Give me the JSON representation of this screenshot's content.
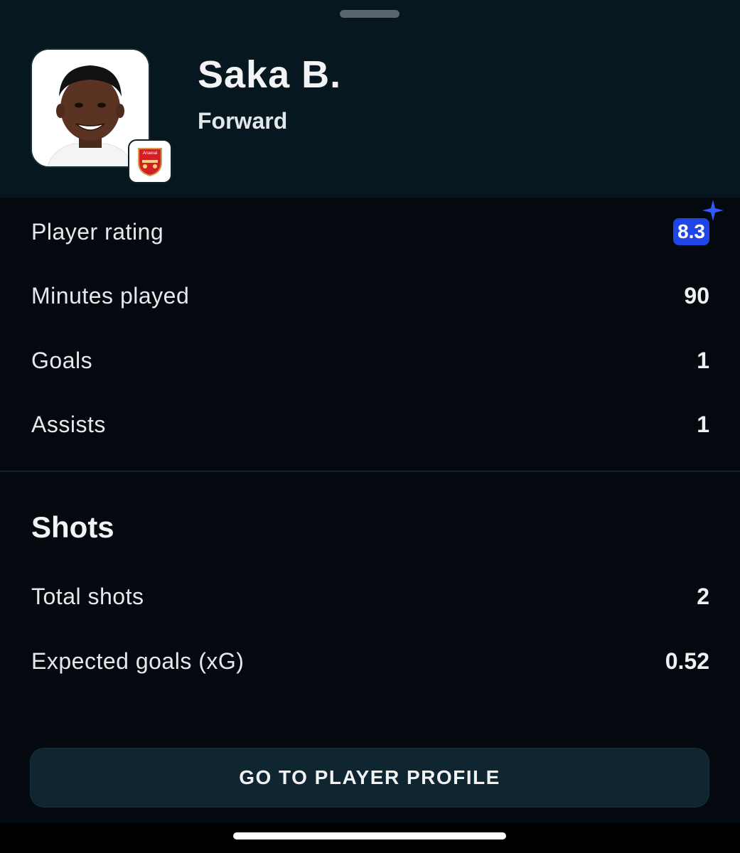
{
  "player": {
    "name": "Saka B.",
    "position": "Forward",
    "club_badge_text": "Arsenal"
  },
  "summary_stats": [
    {
      "label": "Player rating",
      "value": "8.3"
    },
    {
      "label": "Minutes played",
      "value": "90"
    },
    {
      "label": "Goals",
      "value": "1"
    },
    {
      "label": "Assists",
      "value": "1"
    }
  ],
  "shots": {
    "title": "Shots",
    "rows": [
      {
        "label": "Total shots",
        "value": "2"
      },
      {
        "label": "Expected goals (xG)",
        "value": "0.52"
      }
    ]
  },
  "actions": {
    "profile_button": "GO TO PLAYER PROFILE"
  },
  "colors": {
    "rating_badge": "#1f45e6",
    "header_bg": "#07171f",
    "sheet_bg": "#03090f",
    "button_bg": "#0f2630"
  },
  "icons": {
    "rating_star": "sparkle-icon",
    "club": "arsenal-crest-icon"
  }
}
